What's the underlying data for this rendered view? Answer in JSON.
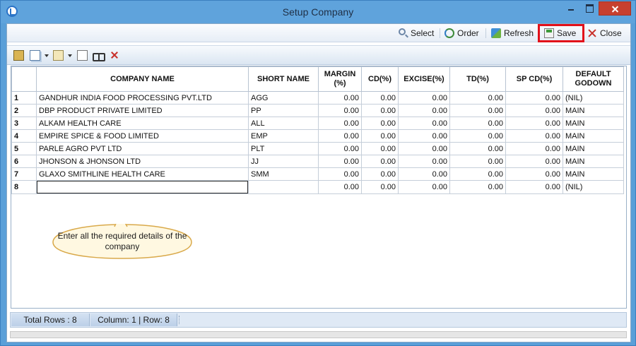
{
  "window": {
    "title": "Setup Company"
  },
  "commands": {
    "select": "Select",
    "order": "Order",
    "refresh": "Refresh",
    "save": "Save",
    "close": "Close"
  },
  "grid": {
    "columns": [
      "",
      "COMPANY NAME",
      "SHORT NAME",
      "MARGIN (%)",
      "CD(%)",
      "EXCISE(%)",
      "TD(%)",
      "SP CD(%)",
      "DEFAULT GODOWN"
    ],
    "rows": [
      [
        "1",
        "GANDHUR INDIA FOOD PROCESSING PVT.LTD",
        "AGG",
        "0.00",
        "0.00",
        "0.00",
        "0.00",
        "0.00",
        "(NIL)"
      ],
      [
        "2",
        "DBP PRODUCT PRIVATE LIMITED",
        "PP",
        "0.00",
        "0.00",
        "0.00",
        "0.00",
        "0.00",
        "MAIN"
      ],
      [
        "3",
        "ALKAM HEALTH CARE",
        "ALL",
        "0.00",
        "0.00",
        "0.00",
        "0.00",
        "0.00",
        "MAIN"
      ],
      [
        "4",
        "EMPIRE SPICE & FOOD LIMITED",
        "EMP",
        "0.00",
        "0.00",
        "0.00",
        "0.00",
        "0.00",
        "MAIN"
      ],
      [
        "5",
        "PARLE AGRO PVT LTD",
        "PLT",
        "0.00",
        "0.00",
        "0.00",
        "0.00",
        "0.00",
        "MAIN"
      ],
      [
        "6",
        "JHONSON & JHONSON LTD",
        "JJ",
        "0.00",
        "0.00",
        "0.00",
        "0.00",
        "0.00",
        "MAIN"
      ],
      [
        "7",
        "GLAXO SMITHLINE HEALTH CARE",
        "SMM",
        "0.00",
        "0.00",
        "0.00",
        "0.00",
        "0.00",
        "MAIN"
      ],
      [
        "8",
        "",
        "",
        "0.00",
        "0.00",
        "0.00",
        "0.00",
        "0.00",
        "(NIL)"
      ]
    ]
  },
  "callout": {
    "text": "Enter all the required details of the company"
  },
  "status": {
    "total_rows": "Total Rows : 8",
    "position": "Column: 1 | Row: 8"
  },
  "colors": {
    "highlight": "#e2101a",
    "titlebar": "#5fa3dc"
  }
}
